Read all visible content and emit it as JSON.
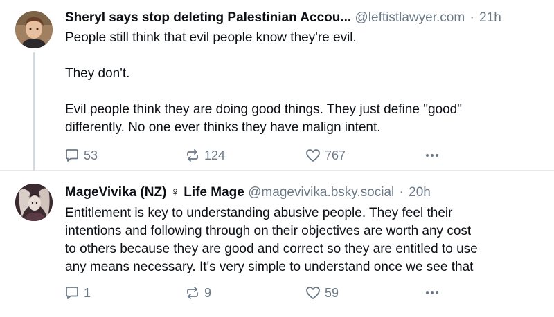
{
  "posts": [
    {
      "author_name": "Sheryl says stop deleting Palestinian Accou...",
      "handle": "@leftistlawyer.com",
      "separator": "·",
      "timestamp": "21h",
      "text": "People still think that evil people know they're evil.\n\nThey don't.\n\nEvil people think they are doing good things. They just define \"good\"\ndifferently. No one ever thinks they have malign intent.",
      "reply_count": "53",
      "repost_count": "124",
      "like_count": "767",
      "icons": {
        "reply": "reply-bubble-icon",
        "repost": "repost-arrows-icon",
        "like": "heart-icon",
        "more": "ellipsis-icon"
      }
    },
    {
      "author_name": "MageVivika (NZ) ♀ Life Mage",
      "handle": "@magevivika.bsky.social",
      "separator": "·",
      "timestamp": "20h",
      "text": "Entitlement is key to understanding abusive people. They feel their\nintentions and following through on their objectives are worth any cost\nto others because they are good and correct so they are entitled to use\nany means necessary. It's very simple to understand once we see that",
      "reply_count": "1",
      "repost_count": "9",
      "like_count": "59",
      "icons": {
        "reply": "reply-bubble-icon",
        "repost": "repost-arrows-icon",
        "like": "heart-icon",
        "more": "ellipsis-icon"
      }
    }
  ],
  "colors": {
    "text": "#0b0f14",
    "muted": "#6b7886",
    "thread_line": "#d4d9de",
    "divider": "#e6e9ed"
  }
}
